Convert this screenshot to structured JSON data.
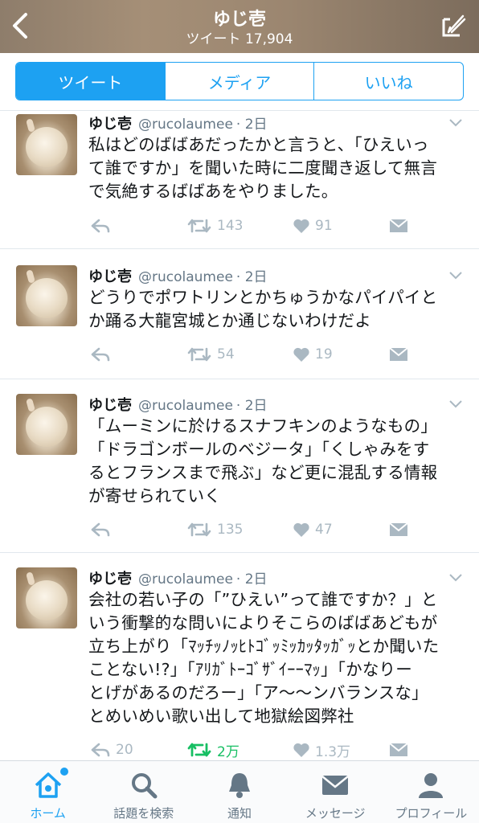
{
  "header": {
    "title": "ゆじ壱",
    "subtitle": "ツイート 17,904"
  },
  "tabs": [
    {
      "label": "ツイート",
      "active": true
    },
    {
      "label": "メディア",
      "active": false
    },
    {
      "label": "いいね",
      "active": false
    }
  ],
  "tweets": [
    {
      "name": "ゆじ壱",
      "handle": "@rucolaumee",
      "time": "· 2日",
      "text": "私はどのばばあだったかと言うと、「ひえいっ\nて誰ですか」を聞いた時に二度聞き返して無言\nで気絶するばばあをやりました。",
      "retweets": "143",
      "likes": "91",
      "retweeted": false
    },
    {
      "name": "ゆじ壱",
      "handle": "@rucolaumee",
      "time": "· 2日",
      "text": "どうりでポワトリンとかちゅうかなパイパイと\nか踊る大龍宮城とか通じないわけだよ",
      "retweets": "54",
      "likes": "19",
      "retweeted": false
    },
    {
      "name": "ゆじ壱",
      "handle": "@rucolaumee",
      "time": "· 2日",
      "text": "「ムーミンに於けるスナフキンのようなもの」\n「ドラゴンボールのベジータ」「くしゃみをす\nるとフランスまで飛ぶ」など更に混乱する情報\nが寄せられていく",
      "retweets": "135",
      "likes": "47",
      "retweeted": false
    },
    {
      "name": "ゆじ壱",
      "handle": "@rucolaumee",
      "time": "· 2日",
      "text": "会社の若い子の「”ひえい”って誰ですか？」と\nいう衝撃的な問いによりそこらのばばあどもが\n立ち上がり「ﾏｯﾁｯﾉｯﾋﾄｺﾞｯﾐｯｶｯﾀｯｶﾞｯとか聞いた\nことない!?」「ｱﾘｶﾞﾄｰｺﾞｻﾞｲｰｰﾏｯ」「かなりー\nとげがあるのだろー」「ア～～ンバランスな」\nとめいめい歌い出して地獄絵図弊社",
      "replies": "20",
      "retweets": "2万",
      "likes": "1.3万",
      "retweeted": true
    }
  ],
  "tabbar": [
    {
      "label": "ホーム",
      "icon": "home-icon",
      "active": true
    },
    {
      "label": "話題を検索",
      "icon": "search-icon",
      "active": false
    },
    {
      "label": "通知",
      "icon": "bell-icon",
      "active": false
    },
    {
      "label": "メッセージ",
      "icon": "envelope-icon",
      "active": false
    },
    {
      "label": "プロフィール",
      "icon": "profile-icon",
      "active": false
    }
  ],
  "colors": {
    "accent": "#1da1f2",
    "retweet_on": "#17bf63",
    "muted": "#aab8c2"
  }
}
